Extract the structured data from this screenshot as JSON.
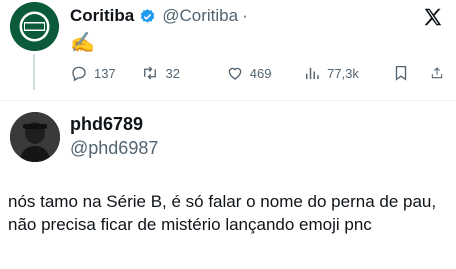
{
  "tweet": {
    "author_name": "Coritiba",
    "author_handle": "@Coritiba",
    "separator": "·",
    "body": "✍️",
    "stats": {
      "replies": "137",
      "retweets": "32",
      "likes": "469",
      "views": "77,3k"
    }
  },
  "reply": {
    "author_name": "phd6789",
    "author_handle": "@phd6987",
    "body": "nós tamo na Série B, é só falar o nome do perna de pau, não precisa ficar de mistério lançando emoji pnc"
  },
  "colors": {
    "verified": "#1d9bf0",
    "muted": "#536471",
    "club_green": "#0b5a3a"
  },
  "icons": [
    "verified-badge-icon",
    "x-logo-icon",
    "reply-icon",
    "retweet-icon",
    "like-icon",
    "views-icon",
    "bookmark-icon",
    "share-icon"
  ]
}
